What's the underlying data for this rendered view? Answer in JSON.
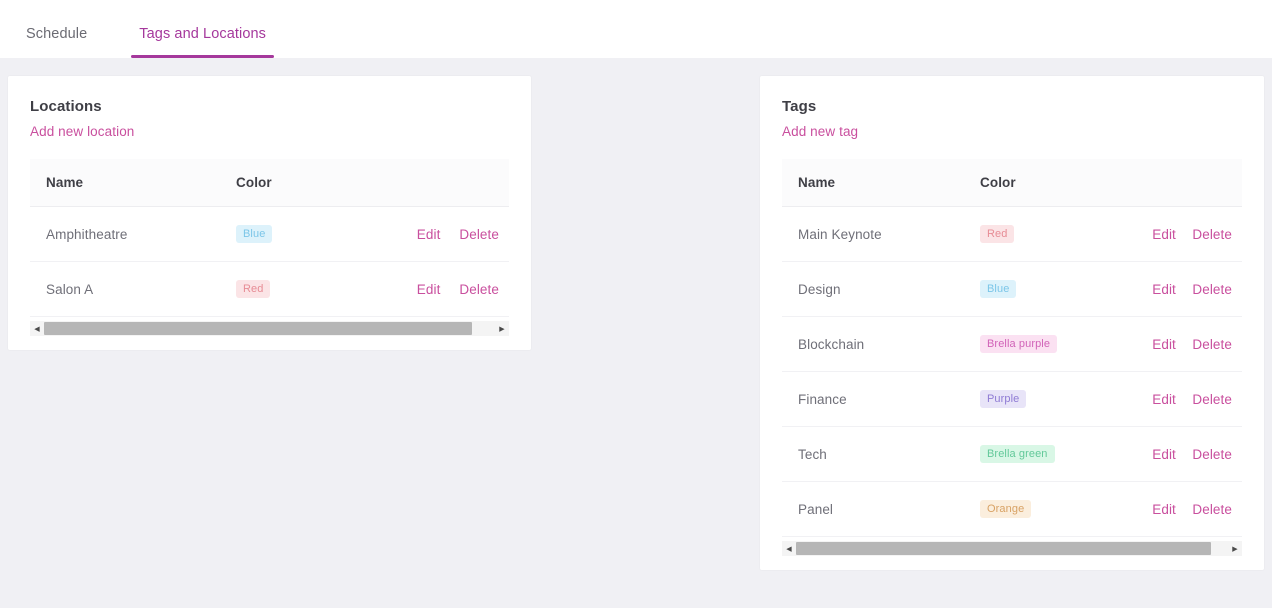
{
  "tabs": [
    {
      "label": "Schedule",
      "active": false
    },
    {
      "label": "Tags and Locations",
      "active": true
    }
  ],
  "colors": {
    "accent_pink": "#c94f9e",
    "tab_active": "#a5389c",
    "page_background": "#f0f0f4",
    "panel_background": "#ffffff",
    "text_primary": "#3f3f46",
    "text_secondary": "#6f6f78"
  },
  "locations_panel": {
    "title": "Locations",
    "add_label": "Add new location",
    "columns": [
      "Name",
      "Color"
    ],
    "edit_label": "Edit",
    "delete_label": "Delete",
    "rows": [
      {
        "name": "Amphitheatre",
        "color_label": "Blue",
        "badge_bg": "#ddf2fb",
        "badge_fg": "#7cc6e8",
        "edit": "Edit",
        "delete": "Delete"
      },
      {
        "name": "Salon A",
        "color_label": "Red",
        "badge_bg": "#fbe4e6",
        "badge_fg": "#e78c95",
        "edit": "Edit",
        "delete": "Delete"
      }
    ]
  },
  "tags_panel": {
    "title": "Tags",
    "add_label": "Add new tag",
    "columns": [
      "Name",
      "Color"
    ],
    "edit_label": "Edit",
    "delete_label": "Delete",
    "rows": [
      {
        "name": "Main Keynote",
        "color_label": "Red",
        "badge_bg": "#fbe4e6",
        "badge_fg": "#e78c95",
        "edit": "Edit",
        "delete": "Delete"
      },
      {
        "name": "Design",
        "color_label": "Blue",
        "badge_bg": "#ddf2fb",
        "badge_fg": "#7cc6e8",
        "edit": "Edit",
        "delete": "Delete"
      },
      {
        "name": "Blockchain",
        "color_label": "Brella purple",
        "badge_bg": "#fbe1f2",
        "badge_fg": "#d163b8",
        "edit": "Edit",
        "delete": "Delete"
      },
      {
        "name": "Finance",
        "color_label": "Purple",
        "badge_bg": "#e8e4f8",
        "badge_fg": "#8f7bd4",
        "edit": "Edit",
        "delete": "Delete"
      },
      {
        "name": "Tech",
        "color_label": "Brella green",
        "badge_bg": "#d9f7e6",
        "badge_fg": "#63c99a",
        "edit": "Edit",
        "delete": "Delete"
      },
      {
        "name": "Panel",
        "color_label": "Orange",
        "badge_bg": "#fbeedd",
        "badge_fg": "#d8a265",
        "edit": "Edit",
        "delete": "Delete"
      }
    ]
  },
  "scrollbars": {
    "left_arrow_glyph": "◀",
    "right_arrow_glyph": "▶"
  }
}
